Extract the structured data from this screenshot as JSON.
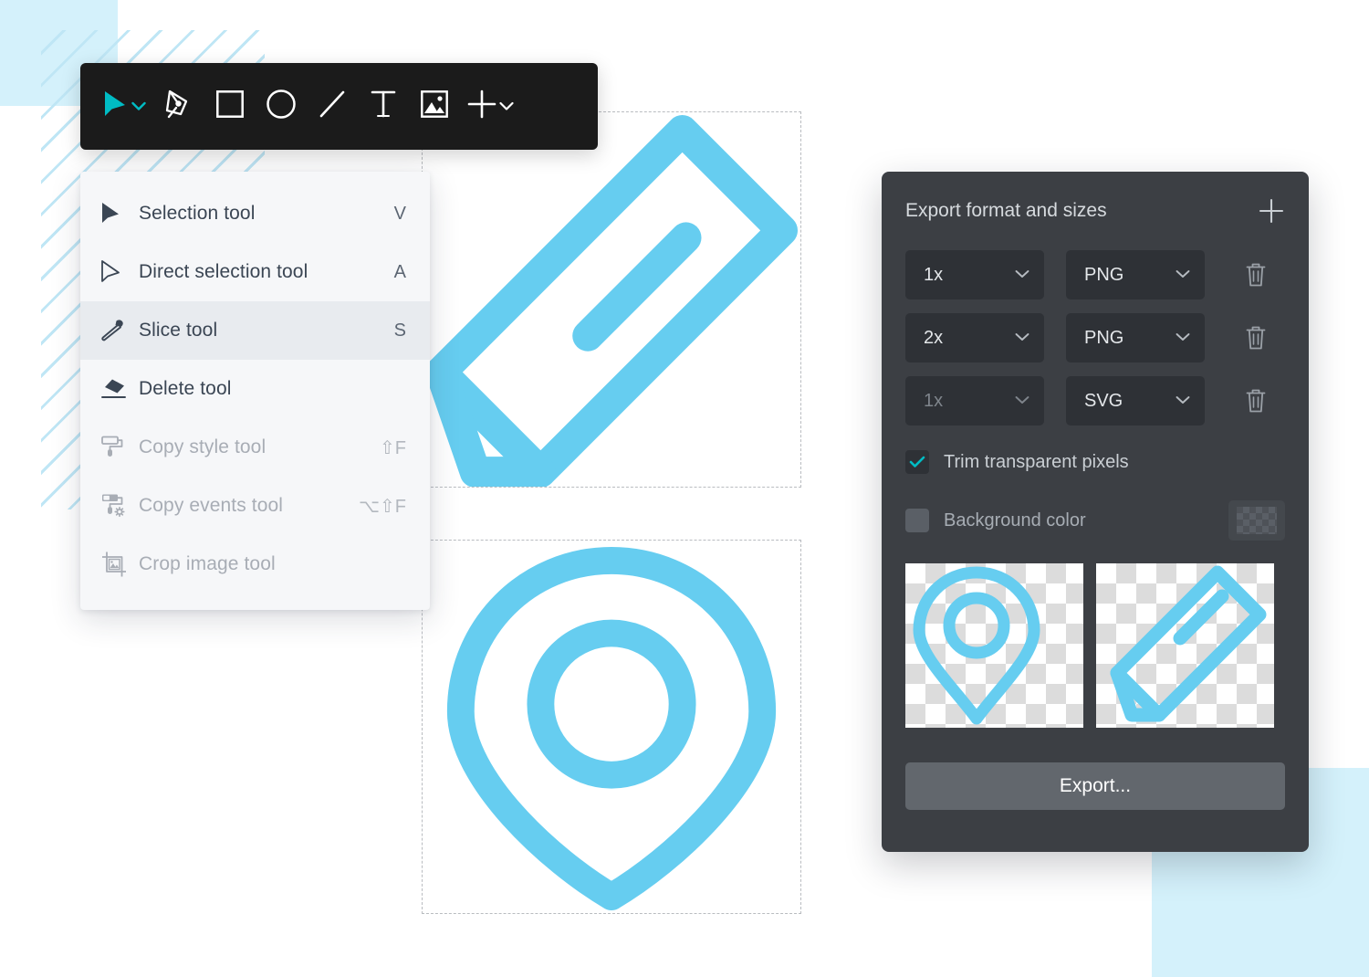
{
  "theme": {
    "accent_teal": "#00bcc4",
    "icon_blue": "#66cdf0",
    "panel_bg": "#3c3f44",
    "toolbar_bg": "#1b1b1b",
    "menu_bg": "#f6f7f9",
    "deco_blue": "#d4f1fb"
  },
  "toolbar": {
    "tools": [
      {
        "name": "selection-tool",
        "icon": "cursor-arrow-icon",
        "active": true,
        "has_caret": true
      },
      {
        "name": "pen-tool",
        "icon": "pen-nib-icon",
        "active": false,
        "has_caret": false
      },
      {
        "name": "rectangle-tool",
        "icon": "square-icon",
        "active": false,
        "has_caret": false
      },
      {
        "name": "ellipse-tool",
        "icon": "circle-icon",
        "active": false,
        "has_caret": false
      },
      {
        "name": "line-tool",
        "icon": "line-icon",
        "active": false,
        "has_caret": false
      },
      {
        "name": "text-tool",
        "icon": "text-t-icon",
        "active": false,
        "has_caret": false
      },
      {
        "name": "image-tool",
        "icon": "image-icon",
        "active": false,
        "has_caret": false
      },
      {
        "name": "add-tool",
        "icon": "plus-icon",
        "active": false,
        "has_caret": true
      }
    ]
  },
  "menu": {
    "items": [
      {
        "label": "Selection tool",
        "shortcut": "V",
        "icon": "cursor-filled-icon",
        "state": "normal"
      },
      {
        "label": "Direct selection tool",
        "shortcut": "A",
        "icon": "cursor-outline-icon",
        "state": "normal"
      },
      {
        "label": "Slice tool",
        "shortcut": "S",
        "icon": "knife-icon",
        "state": "selected"
      },
      {
        "label": "Delete tool",
        "shortcut": "",
        "icon": "eraser-icon",
        "state": "normal"
      },
      {
        "label": "Copy style tool",
        "shortcut": "⇧F",
        "icon": "paint-roller-icon",
        "state": "disabled"
      },
      {
        "label": "Copy events tool",
        "shortcut": "⌥⇧F",
        "icon": "paint-roller-gear-icon",
        "state": "disabled"
      },
      {
        "label": "Crop image tool",
        "shortcut": "",
        "icon": "crop-image-icon",
        "state": "disabled"
      }
    ]
  },
  "canvas": {
    "artboards": [
      {
        "name": "artboard-pencil",
        "icon": "pencil-icon"
      },
      {
        "name": "artboard-pin",
        "icon": "location-pin-icon"
      }
    ]
  },
  "export_panel": {
    "title": "Export format and sizes",
    "add_icon": "plus-icon",
    "delete_icon": "trash-icon",
    "rows": [
      {
        "size": "1x",
        "format": "PNG",
        "size_disabled": false
      },
      {
        "size": "2x",
        "format": "PNG",
        "size_disabled": false
      },
      {
        "size": "1x",
        "format": "SVG",
        "size_disabled": true
      }
    ],
    "options": [
      {
        "label": "Trim transparent pixels",
        "checked": true,
        "name": "trim-transparent-pixels"
      },
      {
        "label": "Background color",
        "checked": false,
        "name": "background-color"
      }
    ],
    "swatch_name": "background-color-swatch",
    "previews": [
      {
        "name": "preview-location-pin",
        "icon": "location-pin-icon"
      },
      {
        "name": "preview-pencil",
        "icon": "pencil-icon"
      }
    ],
    "export_button_label": "Export..."
  }
}
